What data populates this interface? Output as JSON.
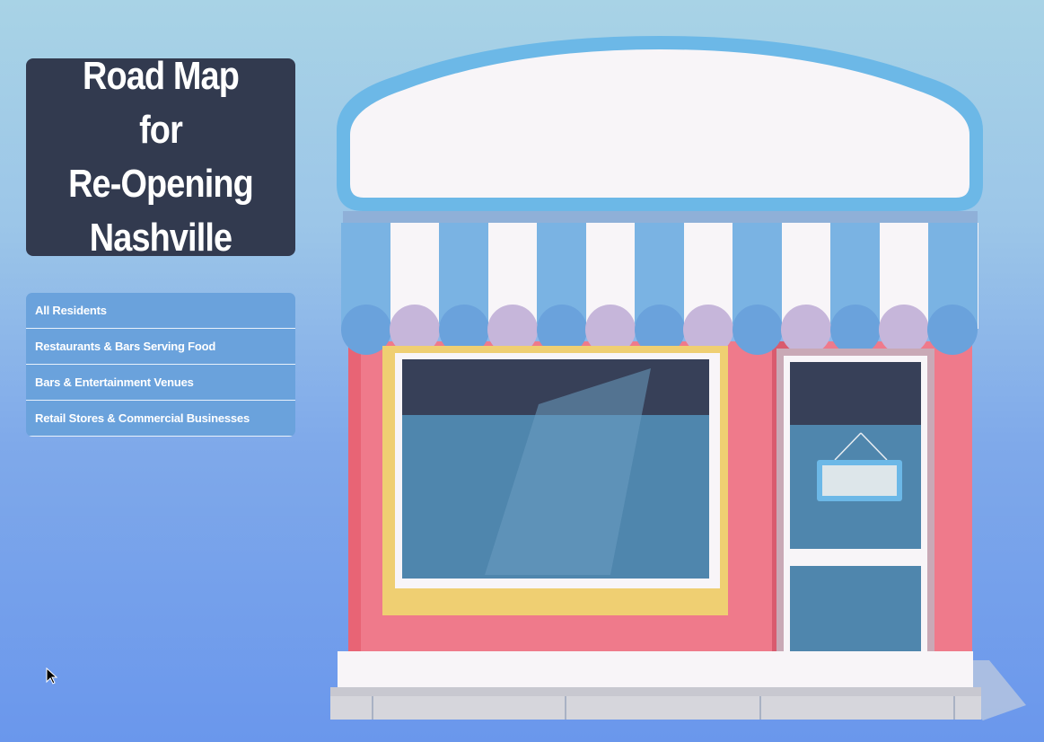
{
  "title": {
    "line1": "Road Map for",
    "line2": "Re-Opening",
    "line3": "Nashville"
  },
  "menu": {
    "items": [
      {
        "label": "All Residents"
      },
      {
        "label": "Restaurants & Bars Serving Food"
      },
      {
        "label": "Bars & Entertainment Venues"
      },
      {
        "label": "Retail Stores & Commercial Businesses"
      }
    ]
  },
  "colors": {
    "title_bg": "#323a4f",
    "menu_bg": "#6aa2dc",
    "awning_blue": "#7ab3e3",
    "storefront_pink": "#ef7a8b",
    "sign_border": "#6cb8e7"
  },
  "icons": {
    "cursor": "mouse-pointer-icon",
    "illustration": "storefront-illustration"
  }
}
